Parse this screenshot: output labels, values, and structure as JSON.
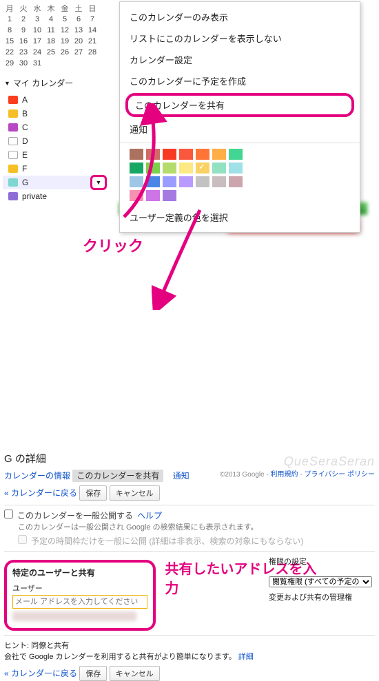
{
  "mini_calendar": {
    "dow": [
      "月",
      "火",
      "水",
      "木",
      "金",
      "土",
      "日"
    ],
    "rows": [
      [
        "1",
        "2",
        "3",
        "4",
        "5",
        "6",
        "7"
      ],
      [
        "8",
        "9",
        "10",
        "11",
        "12",
        "13",
        "14"
      ],
      [
        "15",
        "16",
        "17",
        "18",
        "19",
        "20",
        "21"
      ],
      [
        "22",
        "23",
        "24",
        "25",
        "26",
        "27",
        "28"
      ],
      [
        "29",
        "30",
        "31",
        "",
        "",
        "",
        ""
      ]
    ]
  },
  "sidebar": {
    "header": "マイ カレンダー",
    "items": [
      {
        "label": "A",
        "color": "#fa3e1d"
      },
      {
        "label": "B",
        "color": "#f6bf26"
      },
      {
        "label": "C",
        "color": "#b749c4"
      },
      {
        "label": "D",
        "hollow": true
      },
      {
        "label": "E",
        "hollow": true
      },
      {
        "label": "F",
        "color": "#f6bf26"
      },
      {
        "label": "G",
        "color": "#7dd6d0",
        "selected": true
      },
      {
        "label": "private",
        "color": "#8e6dd7"
      }
    ]
  },
  "menu": {
    "only": "このカレンダーのみ表示",
    "hide": "リストにこのカレンダーを表示しない",
    "settings": "カレンダー設定",
    "create": "このカレンダーに予定を作成",
    "share": "このカレンダーを共有",
    "notify": "通知",
    "custom_color": "ユーザー定義の色を選択",
    "swatches": [
      "#ac725e",
      "#d06b64",
      "#f83a22",
      "#fa573c",
      "#ff7537",
      "#ffad46",
      "#42d692",
      "#16a765",
      "#7bd148",
      "#b3dc6c",
      "#fbe983",
      "#fad165",
      "#92e1c0",
      "#9fe1e7",
      "#9fc6e7",
      "#4986e7",
      "#9a9cff",
      "#b99aff",
      "#c2c2c2",
      "#cabdbf",
      "#cca6ac",
      "#f691b2",
      "#cd74e6",
      "#a47ae2"
    ],
    "checked_swatch": 11
  },
  "annotations": {
    "click": "クリック",
    "enter": "共有したいアドレスを入力"
  },
  "detail": {
    "title": "G の詳細",
    "tabs": {
      "info": "カレンダーの情報",
      "share": "このカレンダーを共有",
      "notify": "通知"
    },
    "back": "« カレンダーに戻る",
    "save": "保存",
    "cancel": "キャンセル",
    "pub": "このカレンダーを一般公開する",
    "help": "ヘルプ",
    "pub_note": "このカレンダーは一般公開され Google の検索結果にも表示されます。",
    "frame_only": "予定の時間枠だけを一般に公開 (詳細は非表示、検索の対象にもならない)",
    "share_h": "特定のユーザーと共有",
    "user": "ユーザー",
    "placeholder": "メール アドレスを入力してください",
    "perm_h": "権限の設定",
    "perm_opt": "閲覧権限 (すべての予定の",
    "perm2": "変更および共有の管理権",
    "hint_h": "ヒント: 同僚と共有",
    "hint": "会社で Google カレンダーを利用すると共有がより簡単になります。",
    "detail_link": "詳細"
  },
  "footer": {
    "wm": "QueSeraSeran",
    "cp": "©2013 Google - ",
    "l1": "利用規約",
    "l2": "プライバシー ポリシー"
  }
}
